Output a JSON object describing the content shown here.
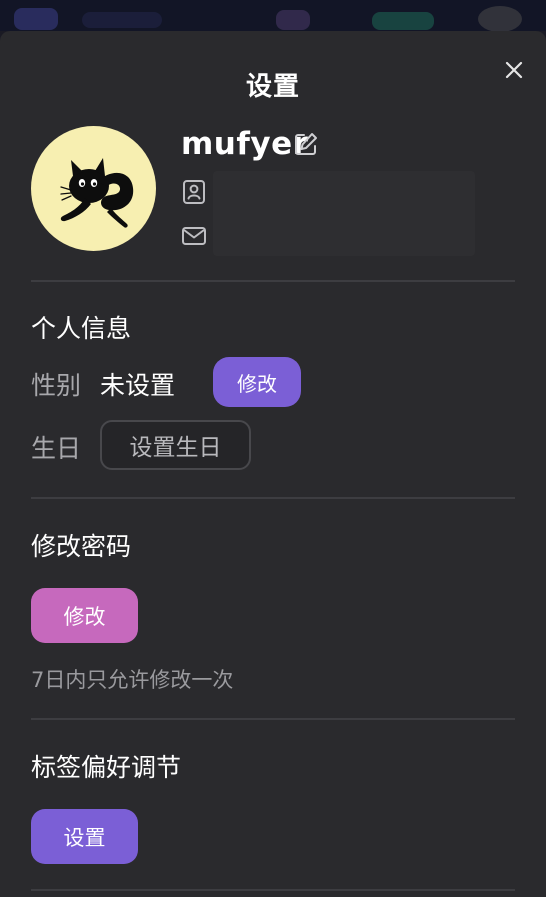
{
  "modal": {
    "title": "设置",
    "close_icon": "close-icon"
  },
  "profile": {
    "username": "mufyer",
    "edit_icon": "pencil-edit-icon",
    "id_icon": "contact-card-icon",
    "email_icon": "mail-icon",
    "avatar": "black-cat-avatar"
  },
  "personal_info": {
    "title": "个人信息",
    "gender_label": "性别",
    "gender_value": "未设置",
    "gender_button": "修改",
    "birthday_label": "生日",
    "birthday_button": "设置生日"
  },
  "password": {
    "title": "修改密码",
    "button": "修改",
    "note": "7日内只允许修改一次"
  },
  "tag_preference": {
    "title": "标签偏好调节",
    "button": "设置"
  },
  "colors": {
    "background": "#2a2a2d",
    "accent_purple": "#7b5fd6",
    "accent_pink": "#c669bd",
    "avatar_bg": "#f7efb1"
  }
}
